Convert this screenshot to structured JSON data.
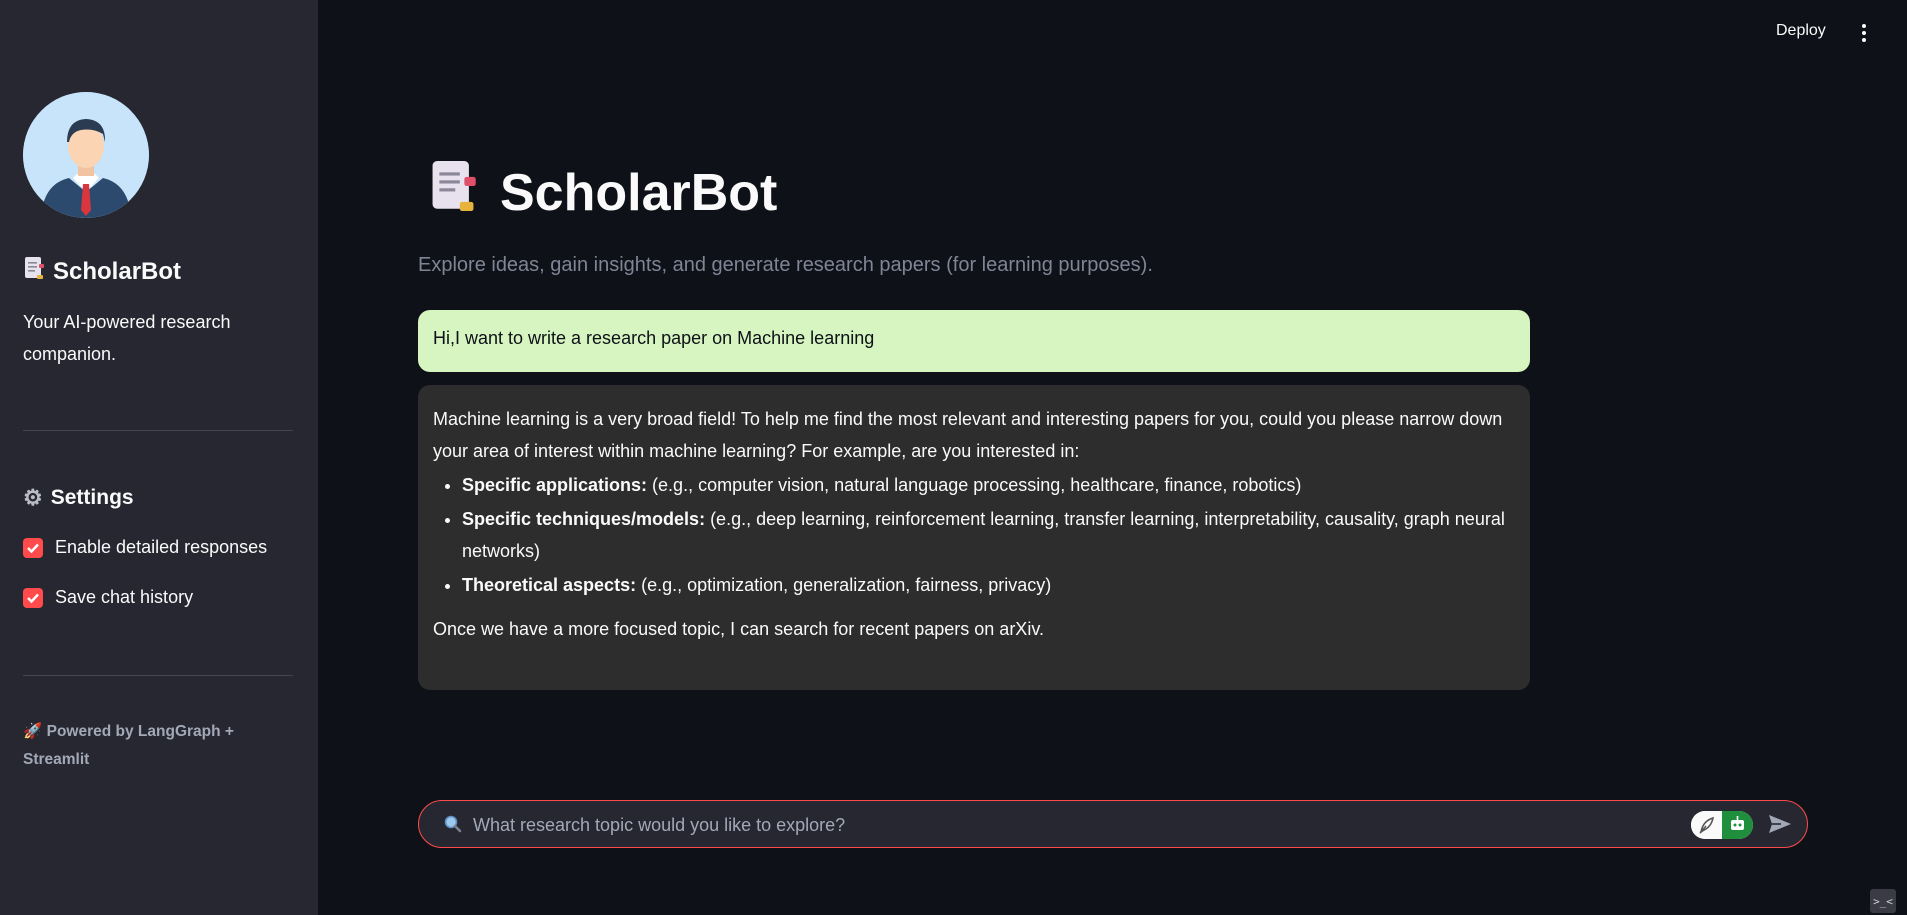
{
  "sidebar": {
    "title": "ScholarBot",
    "title_icon": "notepad-icon",
    "description": "Your AI-powered research companion.",
    "settings_heading": "Settings",
    "settings_icon": "gear-icon",
    "options": [
      {
        "label": "Enable detailed responses",
        "checked": true
      },
      {
        "label": "Save chat history",
        "checked": true
      }
    ],
    "footer_icon": "rocket-icon",
    "footer": "Powered by LangGraph + Streamlit"
  },
  "header": {
    "deploy_label": "Deploy",
    "menu_icon": "kebab-menu-icon"
  },
  "main": {
    "title": "ScholarBot",
    "title_icon": "notepad-icon",
    "subtitle": "Explore ideas, gain insights, and generate research papers (for learning purposes)."
  },
  "chat": {
    "user_message": "Hi,I want to write a research paper on Machine learning",
    "bot_intro": "Machine learning is a very broad field! To help me find the most relevant and interesting papers for you, could you please narrow down your area of interest within machine learning? For example, are you interested in:",
    "bot_list": [
      {
        "bold": "Specific applications:",
        "text": " (e.g., computer vision, natural language processing, healthcare, finance, robotics)"
      },
      {
        "bold": "Specific techniques/models:",
        "text": " (e.g., deep learning, reinforcement learning, transfer learning, interpretability, causality, graph neural networks)"
      },
      {
        "bold": "Theoretical aspects:",
        "text": " (e.g., optimization, generalization, fairness, privacy)"
      }
    ],
    "bot_outro": "Once we have a more focused topic, I can search for recent papers on arXiv."
  },
  "input": {
    "placeholder": "What research topic would you like to explore?",
    "search_icon": "search-icon",
    "send_icon": "send-icon"
  },
  "colors": {
    "accent": "#ff4b4b",
    "user_bubble": "#d6f5c1",
    "bot_bubble": "#2d2d2d",
    "sidebar_bg": "#262730",
    "main_bg": "#0e1117"
  }
}
